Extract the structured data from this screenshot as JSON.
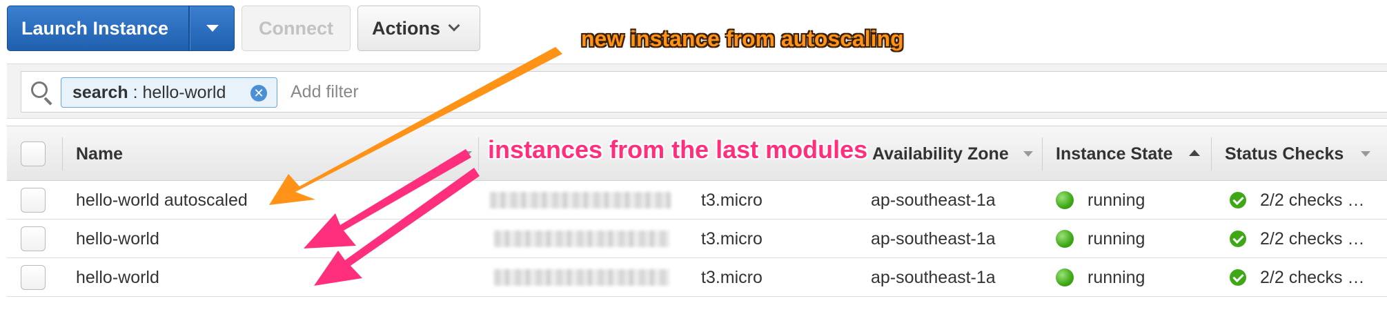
{
  "toolbar": {
    "launch_label": "Launch Instance",
    "connect_label": "Connect",
    "actions_label": "Actions"
  },
  "filter": {
    "chip_key": "search",
    "chip_sep": " : ",
    "chip_value": "hello-world",
    "placeholder": "Add filter"
  },
  "table": {
    "columns": [
      {
        "label": "Name"
      },
      {
        "label": ""
      },
      {
        "label": ""
      },
      {
        "label": "Availability Zone"
      },
      {
        "label": "Instance State"
      },
      {
        "label": "Status Checks"
      }
    ],
    "rows": [
      {
        "name": "hello-world autoscaled",
        "type": "t3.micro",
        "az": "ap-southeast-1a",
        "state": "running",
        "checks": "2/2 checks …"
      },
      {
        "name": "hello-world",
        "type": "t3.micro",
        "az": "ap-southeast-1a",
        "state": "running",
        "checks": "2/2 checks …"
      },
      {
        "name": "hello-world",
        "type": "t3.micro",
        "az": "ap-southeast-1a",
        "state": "running",
        "checks": "2/2 checks …"
      }
    ]
  },
  "annotations": {
    "new_instance": "new instance from autoscaling",
    "last_modules": "instances from the last modules"
  },
  "colors": {
    "primary_button": "#2a6bbd",
    "running": "#3ea716",
    "annotation_orange": "#ff9317",
    "annotation_pink": "#ff2f7d"
  }
}
